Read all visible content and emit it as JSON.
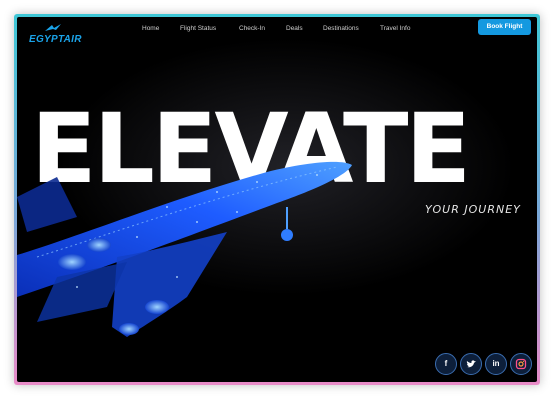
{
  "brand": {
    "name": "EGYPTAIR",
    "color": "#1aa3e8"
  },
  "nav": {
    "items": [
      "Home",
      "Flight Status",
      "Check-In",
      "Deals",
      "Destinations",
      "Travel Info"
    ],
    "cta": "Book Flight"
  },
  "hero": {
    "headline": "ELEVATE",
    "tagline": "YOUR JOURNEY"
  },
  "social": [
    {
      "name": "facebook-icon",
      "label": "f"
    },
    {
      "name": "twitter-icon",
      "label": ""
    },
    {
      "name": "linkedin-icon",
      "label": "in"
    },
    {
      "name": "instagram-icon",
      "label": ""
    }
  ],
  "colors": {
    "background": "#000000",
    "accent": "#1499e0",
    "frame_top": "#3fc7d6",
    "frame_bottom": "#e98cc8",
    "plane_glow": "#1e5cff"
  }
}
